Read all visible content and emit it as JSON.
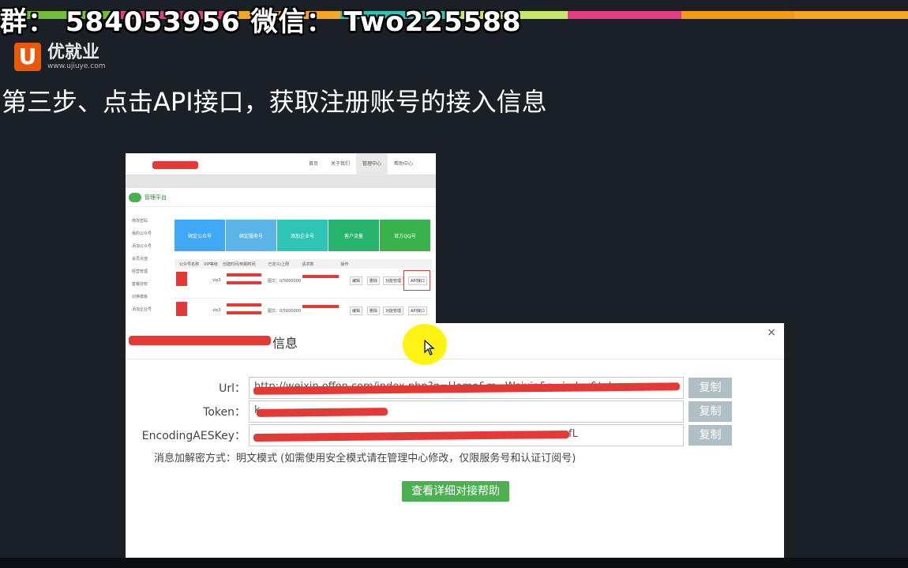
{
  "banner": {
    "text": "群：  584053956   微信：  Two225588"
  },
  "strip_colors": [
    "#6fbf3a",
    "#e73c84",
    "#f5a623",
    "#2ec4b6",
    "#c8e66b",
    "#e73c84",
    "#f39c12",
    "#f5a623"
  ],
  "logo": {
    "mark": "U",
    "name": "优就业",
    "url": "www.ujiuye.com"
  },
  "step_title": "第三步、点击API接口，获取注册账号的接入信息",
  "background_screenshot": {
    "nav": [
      "首页",
      "关于我们",
      "管理中心",
      "帮助中心"
    ],
    "active_nav": "管理中心",
    "platform_title": "管理平台",
    "sidebar": [
      "修改密码",
      "我的公众号",
      "添加公众号",
      "会员充值",
      "经营管理",
      "套餐授权",
      "切换模板",
      "添加企业号"
    ],
    "tiles": [
      "绑定公众号",
      "绑定服务号",
      "添加企业号",
      "客户流量",
      "官方QQ号"
    ],
    "tile_colors": [
      "#3fa9f5",
      "#5ab4e6",
      "#2ec4b6",
      "#26b36b",
      "#37b34a"
    ],
    "table_headers": [
      "公众号名称",
      "VIP等级",
      "创建时间/到期时间",
      "已定义/上限",
      "请求数",
      "操作"
    ],
    "rows": [
      {
        "vip": "vip3",
        "quota": "图文：0/5000000",
        "actions": [
          "编辑",
          "删除",
          "功能管理",
          "API接口"
        ]
      },
      {
        "vip": "vip3",
        "quota": "图文：0/5000000",
        "actions": [
          "编辑",
          "删除",
          "功能管理",
          "API接口"
        ]
      }
    ]
  },
  "dialog": {
    "title_suffix": "信息",
    "close": "×",
    "fields": [
      {
        "label": "Url：",
        "value": "http://weixin.offen.com/index.php?g=Home&m=Weixin&a=index&token=",
        "copy": "复制"
      },
      {
        "label": "Token：",
        "value": "k",
        "copy": "复制"
      },
      {
        "label": "EncodingAESKey：",
        "value": "fL",
        "copy": "复制"
      }
    ],
    "note": "消息加解密方式：明文模式 (如需使用安全模式请在管理中心修改，仅限服务号和认证订阅号)",
    "help_button": "查看详细对接帮助"
  }
}
